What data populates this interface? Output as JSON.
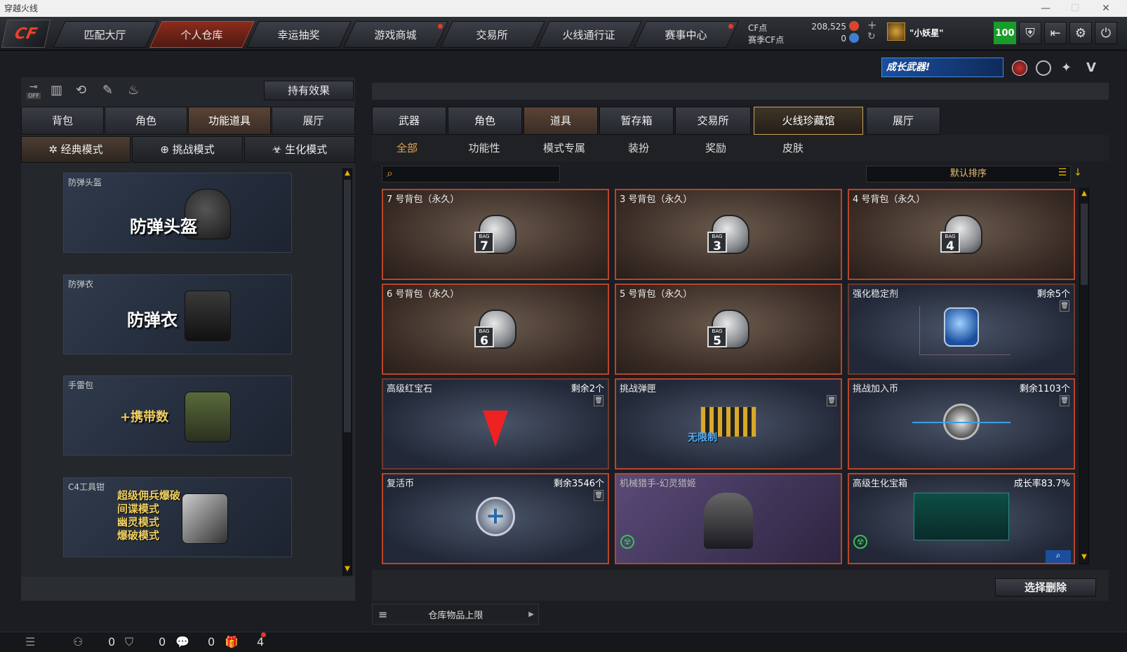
{
  "window": {
    "title": "穿越火线"
  },
  "nav": {
    "tabs": [
      "匹配大厅",
      "个人仓库",
      "幸运抽奖",
      "游戏商城",
      "交易所",
      "火线通行证",
      "赛事中心"
    ],
    "active_index": 1,
    "cf_points_label": "CF点",
    "cf_points_value": "208,525",
    "season_points_label": "赛季CF点",
    "season_points_value": "0",
    "username": "\"小妖星\"",
    "level": "100"
  },
  "banner": {
    "text": "成长武器!"
  },
  "left": {
    "effects_button": "持有效果",
    "toggle_label": "OFF",
    "tabs": [
      "背包",
      "角色",
      "功能道具",
      "展厅"
    ],
    "active_tab": 2,
    "modes": [
      "经典模式",
      "挑战模式",
      "生化模式"
    ],
    "active_mode": 0,
    "cards": [
      {
        "caption": "防弹头盔",
        "text": "防弹头盔"
      },
      {
        "caption": "防弹衣",
        "text": "防弹衣"
      },
      {
        "caption": "手雷包",
        "text": "+携带数"
      },
      {
        "caption": "C4工具钳",
        "lines": [
          "超级佣兵爆破",
          "间谍模式",
          "幽灵模式",
          "爆破模式"
        ]
      }
    ]
  },
  "right": {
    "tabs": [
      "武器",
      "角色",
      "道具",
      "暂存箱",
      "交易所",
      "火线珍藏馆",
      "展厅"
    ],
    "active_tab": 2,
    "subtabs": [
      "全部",
      "功能性",
      "模式专属",
      "装扮",
      "奖励",
      "皮肤"
    ],
    "active_subtab": 0,
    "search_placeholder": "",
    "sort_label": "默认排序",
    "items": [
      {
        "name": "7 号背包（永久）",
        "count": "",
        "bag": "7"
      },
      {
        "name": "3 号背包（永久）",
        "count": "",
        "bag": "3"
      },
      {
        "name": "4 号背包（永久）",
        "count": "",
        "bag": "4"
      },
      {
        "name": "6 号背包（永久）",
        "count": "",
        "bag": "6"
      },
      {
        "name": "5 号背包（永久）",
        "count": "",
        "bag": "5"
      },
      {
        "name": "强化稳定剂",
        "count": "剩余5个"
      },
      {
        "name": "高级红宝石",
        "count": "剩余2个"
      },
      {
        "name": "挑战弹匣",
        "count": "",
        "overlay": "无限制"
      },
      {
        "name": "挑战加入币",
        "count": "剩余1103个"
      },
      {
        "name": "复活币",
        "count": "剩余3546个"
      },
      {
        "name": "机械猎手-幻灵猎姬",
        "count": ""
      },
      {
        "name": "高级生化宝箱",
        "count": "成长率83.7%"
      }
    ],
    "delete_button": "选择删除",
    "storage_limit": "仓库物品上限"
  },
  "bottom": {
    "counts": [
      "0",
      "0",
      "0",
      "4"
    ]
  },
  "colors": {
    "accent": "#e8a54a",
    "active_tab": "#8c2b1c",
    "card_border": "#b8452a"
  }
}
